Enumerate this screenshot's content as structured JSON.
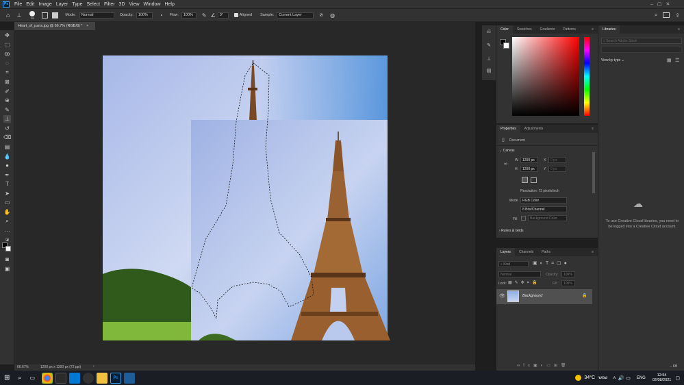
{
  "menu": [
    "File",
    "Edit",
    "Image",
    "Layer",
    "Type",
    "Select",
    "Filter",
    "3D",
    "View",
    "Window",
    "Help"
  ],
  "app_icon": "Ps",
  "options": {
    "brush_size": "28",
    "mode_label": "Mode:",
    "mode": "Normal",
    "opacity_label": "Opacity:",
    "opacity": "100%",
    "flow_label": "Flow:",
    "flow": "100%",
    "angle": "0°",
    "aligned": "Aligned",
    "sample_label": "Sample:",
    "sample": "Current Layer"
  },
  "document": {
    "tab": "Heart_of_paris.jpg @ 66.7% (RGB/8) *",
    "zoom": "66.67%",
    "info": "1200 px x 1200 px (72 ppi)"
  },
  "color_panel": {
    "tabs": [
      "Color",
      "Swatches",
      "Gradients",
      "Patterns"
    ]
  },
  "libraries": {
    "title": "Libraries",
    "search": "Search Adobe Stock",
    "view": "View by type",
    "message": "To use Creative Cloud libraries, you need to be logged into a Creative Cloud account.",
    "kb": "-- KB"
  },
  "properties": {
    "tabs": [
      "Properties",
      "Adjustments"
    ],
    "doc": "Document",
    "canvas": "Canvas",
    "w_label": "W",
    "w": "1200 px",
    "h_label": "H",
    "h": "1200 px",
    "x_label": "X",
    "y_label": "Y",
    "x": "0 px",
    "y": "0 px",
    "resolution": "Resolution: 72 pixels/inch",
    "mode_label": "Mode",
    "mode": "RGB Color",
    "depth": "8 Bits/Channel",
    "fill_label": "Fill",
    "fill": "Background Color",
    "rulers": "Rulers & Grids"
  },
  "layers": {
    "tabs": [
      "Layers",
      "Channels",
      "Paths"
    ],
    "kind": "Kind",
    "blend": "Normal",
    "opacity_label": "Opacity:",
    "opacity": "100%",
    "lock_label": "Lock:",
    "fill_label": "Fill:",
    "fill": "100%",
    "layer_name": "Background"
  },
  "taskbar": {
    "weather": "34°C",
    "weather_word": "שמשי",
    "lang": "ENG",
    "time": "12:54",
    "date": "02/08/2021"
  }
}
